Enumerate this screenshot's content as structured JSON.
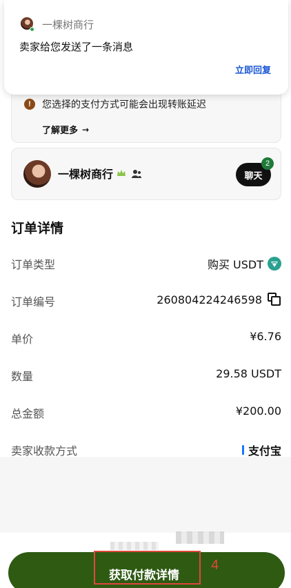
{
  "notification": {
    "app_name": "一棵树商行",
    "message": "卖家给您发送了一条消息",
    "action_label": "立即回复"
  },
  "warning": {
    "text": "您选择的支付方式可能会出现转账延迟",
    "learn_more": "了解更多",
    "icon": "warning-icon"
  },
  "seller": {
    "name": "一棵树商行",
    "chat_label": "聊天",
    "unread_count": "2",
    "badge_colors": {
      "crown": "#8bc34a",
      "merchant": "#333333"
    }
  },
  "order": {
    "section_title": "订单详情",
    "rows": [
      {
        "label": "订单类型",
        "value": "购买 USDT"
      },
      {
        "label": "订单编号",
        "value": "260804224246598"
      },
      {
        "label": "单价",
        "value": "¥6.76"
      },
      {
        "label": "数量",
        "value": "29.58 USDT"
      },
      {
        "label": "总金额",
        "value": "¥200.00"
      },
      {
        "label": "卖家收款方式",
        "value": "支付宝"
      }
    ]
  },
  "cta": {
    "label": "获取付款详情",
    "step_number": "4",
    "button_color": "#2e5a12",
    "highlight_color": "#e0483b"
  }
}
